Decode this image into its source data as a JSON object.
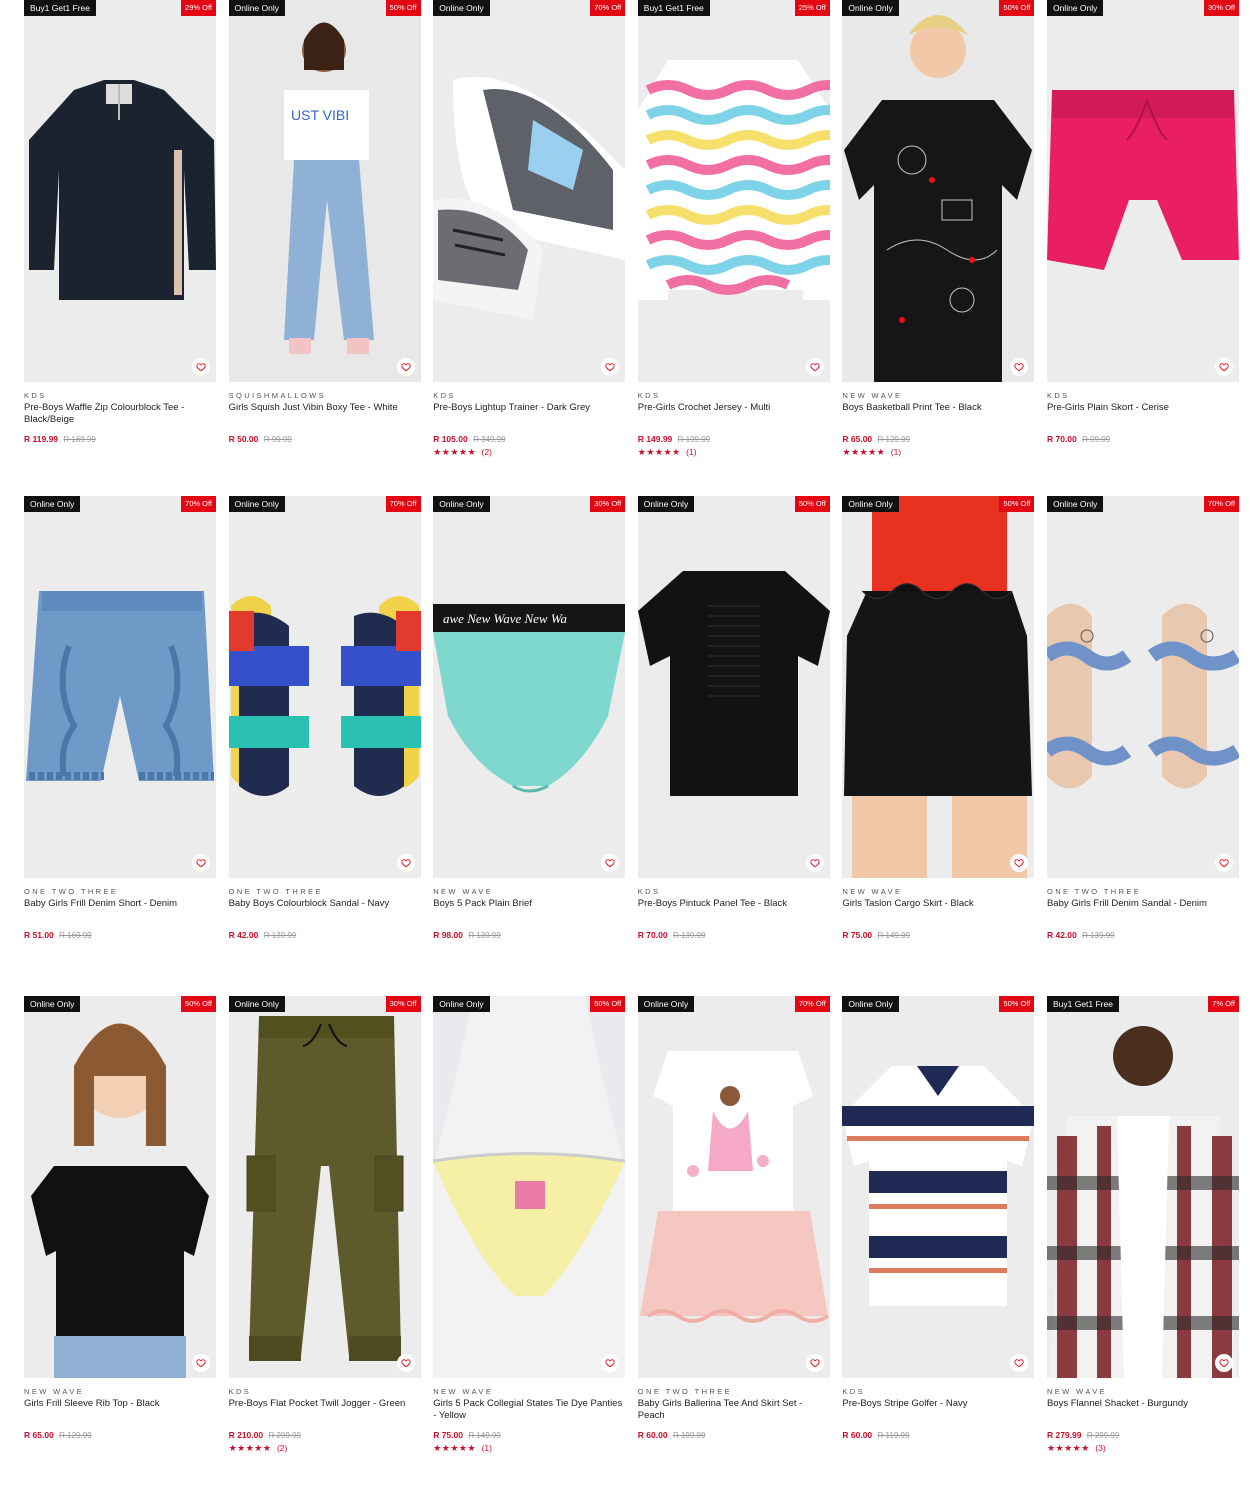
{
  "products": [
    {
      "tag": "Buy1 Get1 Free",
      "discount": "29% Off",
      "brand": "KDS",
      "name": "Pre-Boys Waffle Zip Colourblock Tee - Black/Beige",
      "price": "R 119.99",
      "was": "R 169.99",
      "stars": "",
      "reviews": "",
      "art": "zip-tee"
    },
    {
      "tag": "Online Only",
      "discount": "50% Off",
      "brand": "SQUISHMALLOWS",
      "name": "Girls Squish Just Vibin Boxy Tee - White",
      "price": "R 50.00",
      "was": "R 99.99",
      "stars": "",
      "reviews": "",
      "art": "model-jeans"
    },
    {
      "tag": "Online Only",
      "discount": "70% Off",
      "brand": "KDS",
      "name": "Pre-Boys Lightup Trainer - Dark Grey",
      "price": "R 105.00",
      "was": "R 349.99",
      "stars": "★★★★★",
      "reviews": "(2)",
      "art": "trainer"
    },
    {
      "tag": "Buy1 Get1 Free",
      "discount": "25% Off",
      "brand": "KDS",
      "name": "Pre-Girls Crochet Jersey - Multi",
      "price": "R 149.99",
      "was": "R 199.99",
      "stars": "★★★★★",
      "reviews": "(1)",
      "art": "crochet"
    },
    {
      "tag": "Online Only",
      "discount": "50% Off",
      "brand": "NEW WAVE",
      "name": "Boys Basketball Print Tee - Black",
      "price": "R 65.00",
      "was": "R 129.99",
      "stars": "★★★★★",
      "reviews": "(1)",
      "art": "boy-tee"
    },
    {
      "tag": "Online Only",
      "discount": "30% Off",
      "brand": "KDS",
      "name": "Pre-Girls Plain Skort - Cerise",
      "price": "R 70.00",
      "was": "R 99.99",
      "stars": "",
      "reviews": "",
      "art": "skort"
    },
    {
      "tag": "Online Only",
      "discount": "70% Off",
      "brand": "ONE TWO THREE",
      "name": "Baby Girls Frill Denim Short - Denim",
      "price": "R 51.00",
      "was": "R 169.99",
      "stars": "",
      "reviews": "",
      "art": "denim-short"
    },
    {
      "tag": "Online Only",
      "discount": "70% Off",
      "brand": "ONE TWO THREE",
      "name": "Baby Boys Colourblock Sandal - Navy",
      "price": "R 42.00",
      "was": "R 139.99",
      "stars": "",
      "reviews": "",
      "art": "sandal-navy"
    },
    {
      "tag": "Online Only",
      "discount": "30% Off",
      "brand": "NEW WAVE",
      "name": "Boys 5 Pack Plain Brief",
      "price": "R 98.00",
      "was": "R 139.99",
      "stars": "",
      "reviews": "",
      "art": "brief"
    },
    {
      "tag": "Online Only",
      "discount": "50% Off",
      "brand": "KDS",
      "name": "Pre-Boys Pintuck Panel Tee - Black",
      "price": "R 70.00",
      "was": "R 139.99",
      "stars": "",
      "reviews": "",
      "art": "black-tee"
    },
    {
      "tag": "Online Only",
      "discount": "50% Off",
      "brand": "NEW WAVE",
      "name": "Girls Taslon Cargo Skirt - Black",
      "price": "R 75.00",
      "was": "R 149.99",
      "stars": "",
      "reviews": "",
      "art": "skirt"
    },
    {
      "tag": "Online Only",
      "discount": "70% Off",
      "brand": "ONE TWO THREE",
      "name": "Baby Girls Frill Denim Sandal - Denim",
      "price": "R 42.00",
      "was": "R 139.99",
      "stars": "",
      "reviews": "",
      "art": "sandal-denim"
    },
    {
      "tag": "Online Only",
      "discount": "50% Off",
      "brand": "NEW WAVE",
      "name": "Girls Frill Sleeve Rib Top - Black",
      "price": "R 65.00",
      "was": "R 129.99",
      "stars": "",
      "reviews": "",
      "art": "rib-top"
    },
    {
      "tag": "Online Only",
      "discount": "30% Off",
      "brand": "KDS",
      "name": "Pre-Boys Flat Pocket Twill Jogger - Green",
      "price": "R 210.00",
      "was": "R 299.99",
      "stars": "★★★★★",
      "reviews": "(2)",
      "art": "jogger"
    },
    {
      "tag": "Online Only",
      "discount": "50% Off",
      "brand": "NEW WAVE",
      "name": "Girls 5 Pack Collegial States Tie Dye Panties - Yellow",
      "price": "R 75.00",
      "was": "R 149.99",
      "stars": "★★★★★",
      "reviews": "(1)",
      "art": "panty"
    },
    {
      "tag": "Online Only",
      "discount": "70% Off",
      "brand": "ONE TWO THREE",
      "name": "Baby Girls Ballerina Tee And Skirt Set - Peach",
      "price": "R 60.00",
      "was": "R 199.99",
      "stars": "",
      "reviews": "",
      "art": "ballerina"
    },
    {
      "tag": "Online Only",
      "discount": "50% Off",
      "brand": "KDS",
      "name": "Pre-Boys Stripe Golfer - Navy",
      "price": "R 60.00",
      "was": "R 119.99",
      "stars": "",
      "reviews": "",
      "art": "golfer"
    },
    {
      "tag": "Buy1 Get1 Free",
      "discount": "7% Off",
      "brand": "NEW WAVE",
      "name": "Boys Flannel Shacket - Burgundy",
      "price": "R 279.99",
      "was": "R 299.99",
      "stars": "★★★★★",
      "reviews": "(3)",
      "art": "shacket"
    }
  ]
}
